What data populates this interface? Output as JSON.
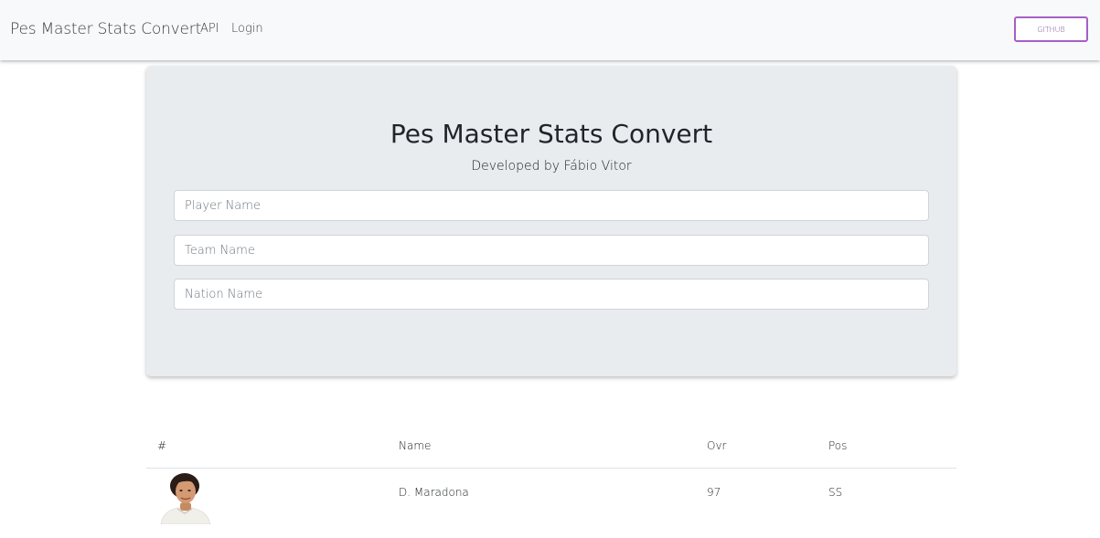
{
  "navbar": {
    "brand": "Pes Master Stats Convert",
    "links": [
      {
        "label": "API"
      },
      {
        "label": "Login"
      }
    ],
    "github_button": "GITHUB"
  },
  "jumbotron": {
    "title": "Pes Master Stats Convert",
    "subtitle": "Developed by Fábio Vitor",
    "fields": {
      "player": {
        "placeholder": "Player Name",
        "value": ""
      },
      "team": {
        "placeholder": "Team Name",
        "value": ""
      },
      "nation": {
        "placeholder": "Nation Name",
        "value": ""
      }
    }
  },
  "table": {
    "headers": [
      "#",
      "Name",
      "Ovr",
      "Pos"
    ],
    "rows": [
      {
        "image": "player-photo",
        "name": "D. Maradona",
        "ovr": "97",
        "pos": "SS"
      }
    ]
  }
}
